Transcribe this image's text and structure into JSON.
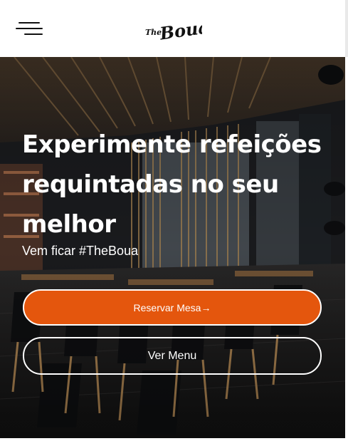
{
  "header": {
    "logo_small": "The",
    "logo_main": "Boua",
    "menu_icon": "hamburger-menu-icon"
  },
  "hero": {
    "title_lines": [
      "Experimente refeições",
      "requintadas no seu",
      "melhor"
    ],
    "subtitle": "Vem ficar #TheBoua",
    "reserve_label": "Reservar Mesa→",
    "menu_label": "Ver Menu"
  },
  "colors": {
    "accent": "#e4560d",
    "text_light": "#ffffff",
    "header_bg": "#ffffff"
  }
}
